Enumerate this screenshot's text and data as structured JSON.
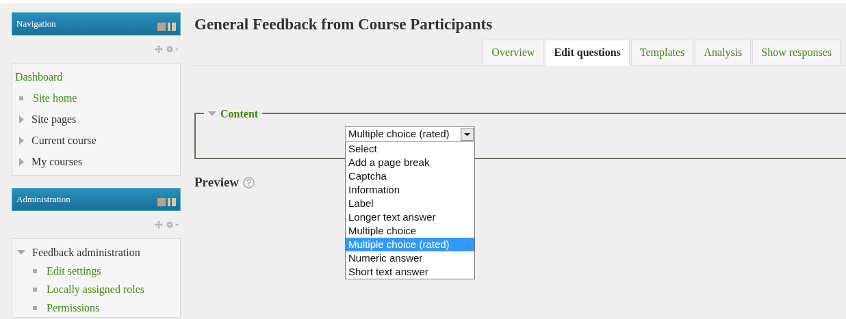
{
  "navigation": {
    "title": "Navigation",
    "items": [
      {
        "label": "Dashboard",
        "kind": "root"
      },
      {
        "label": "Site home",
        "kind": "leaf"
      },
      {
        "label": "Site pages",
        "kind": "branch",
        "expanded": false
      },
      {
        "label": "Current course",
        "kind": "branch",
        "expanded": false
      },
      {
        "label": "My courses",
        "kind": "branch",
        "expanded": false
      }
    ]
  },
  "administration": {
    "title": "Administration",
    "items": [
      {
        "label": "Feedback administration",
        "kind": "branch",
        "expanded": true,
        "children": [
          {
            "label": "Edit settings",
            "kind": "leaf"
          },
          {
            "label": "Locally assigned roles",
            "kind": "leaf"
          },
          {
            "label": "Permissions",
            "kind": "leaf"
          }
        ]
      }
    ]
  },
  "page_title": "General Feedback from Course Participants",
  "tabs": [
    {
      "label": "Overview",
      "selected": false
    },
    {
      "label": "Edit questions",
      "selected": true
    },
    {
      "label": "Templates",
      "selected": false
    },
    {
      "label": "Analysis",
      "selected": false
    },
    {
      "label": "Show responses",
      "selected": false
    }
  ],
  "content": {
    "legend": "Content",
    "expanded": true,
    "select": {
      "value": "Multiple choice (rated)",
      "open": true,
      "options": [
        {
          "label": "Select",
          "selected": false
        },
        {
          "label": "Add a page break",
          "selected": false
        },
        {
          "label": "Captcha",
          "selected": false
        },
        {
          "label": "Information",
          "selected": false
        },
        {
          "label": "Label",
          "selected": false
        },
        {
          "label": "Longer text answer",
          "selected": false
        },
        {
          "label": "Multiple choice",
          "selected": false
        },
        {
          "label": "Multiple choice (rated)",
          "selected": true
        },
        {
          "label": "Numeric answer",
          "selected": false
        },
        {
          "label": "Short text answer",
          "selected": false
        }
      ]
    }
  },
  "preview": {
    "title": "Preview"
  }
}
